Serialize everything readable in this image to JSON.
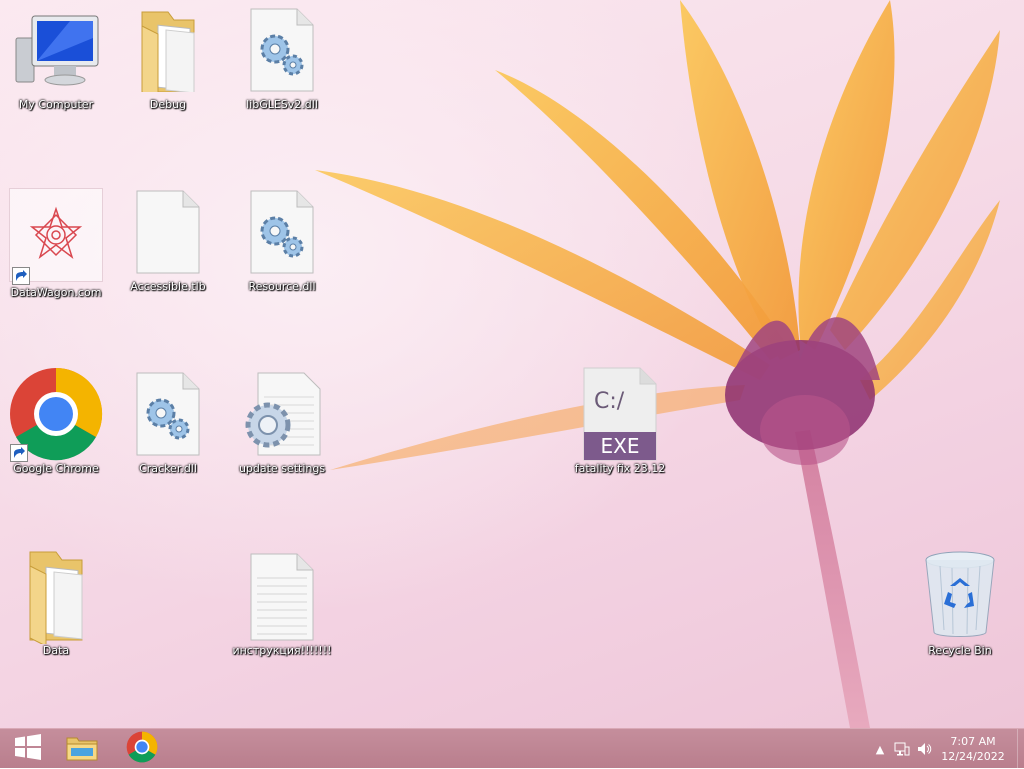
{
  "desktop": {
    "icons": [
      {
        "label": "My Computer",
        "icon": "computer-icon"
      },
      {
        "label": "Debug",
        "icon": "folder-icon"
      },
      {
        "label": "libGLESv2.dll",
        "icon": "dll-gear-file-icon"
      },
      {
        "label": "DataWagon.com",
        "icon": "website-shortcut-icon"
      },
      {
        "label": "Accessible.tlb",
        "icon": "blank-file-icon"
      },
      {
        "label": "Resource.dll",
        "icon": "dll-gear-file-icon"
      },
      {
        "label": "Google Chrome",
        "icon": "chrome-icon"
      },
      {
        "label": "Cracker.dll",
        "icon": "dll-gear-file-icon"
      },
      {
        "label": "update settings",
        "icon": "settings-file-icon"
      },
      {
        "label": "fatality fix 23.12",
        "icon": "exe-file-icon",
        "badge": "EXE",
        "prompt": "C:/"
      },
      {
        "label": "Data",
        "icon": "folder-icon"
      },
      {
        "label": "инструкция!!!!!!!",
        "icon": "text-file-icon"
      },
      {
        "label": "Recycle Bin",
        "icon": "recycle-bin-icon"
      }
    ]
  },
  "taskbar": {
    "start_icon": "windows-logo-icon",
    "pinned": [
      {
        "name": "File Explorer",
        "icon": "file-explorer-icon"
      },
      {
        "name": "Google Chrome",
        "icon": "chrome-icon"
      }
    ],
    "tray": {
      "time": "7:07 AM",
      "date": "12/24/2022"
    }
  },
  "colors": {
    "taskbar": "#bf8695",
    "exe_accent": "#7d5a8c"
  }
}
